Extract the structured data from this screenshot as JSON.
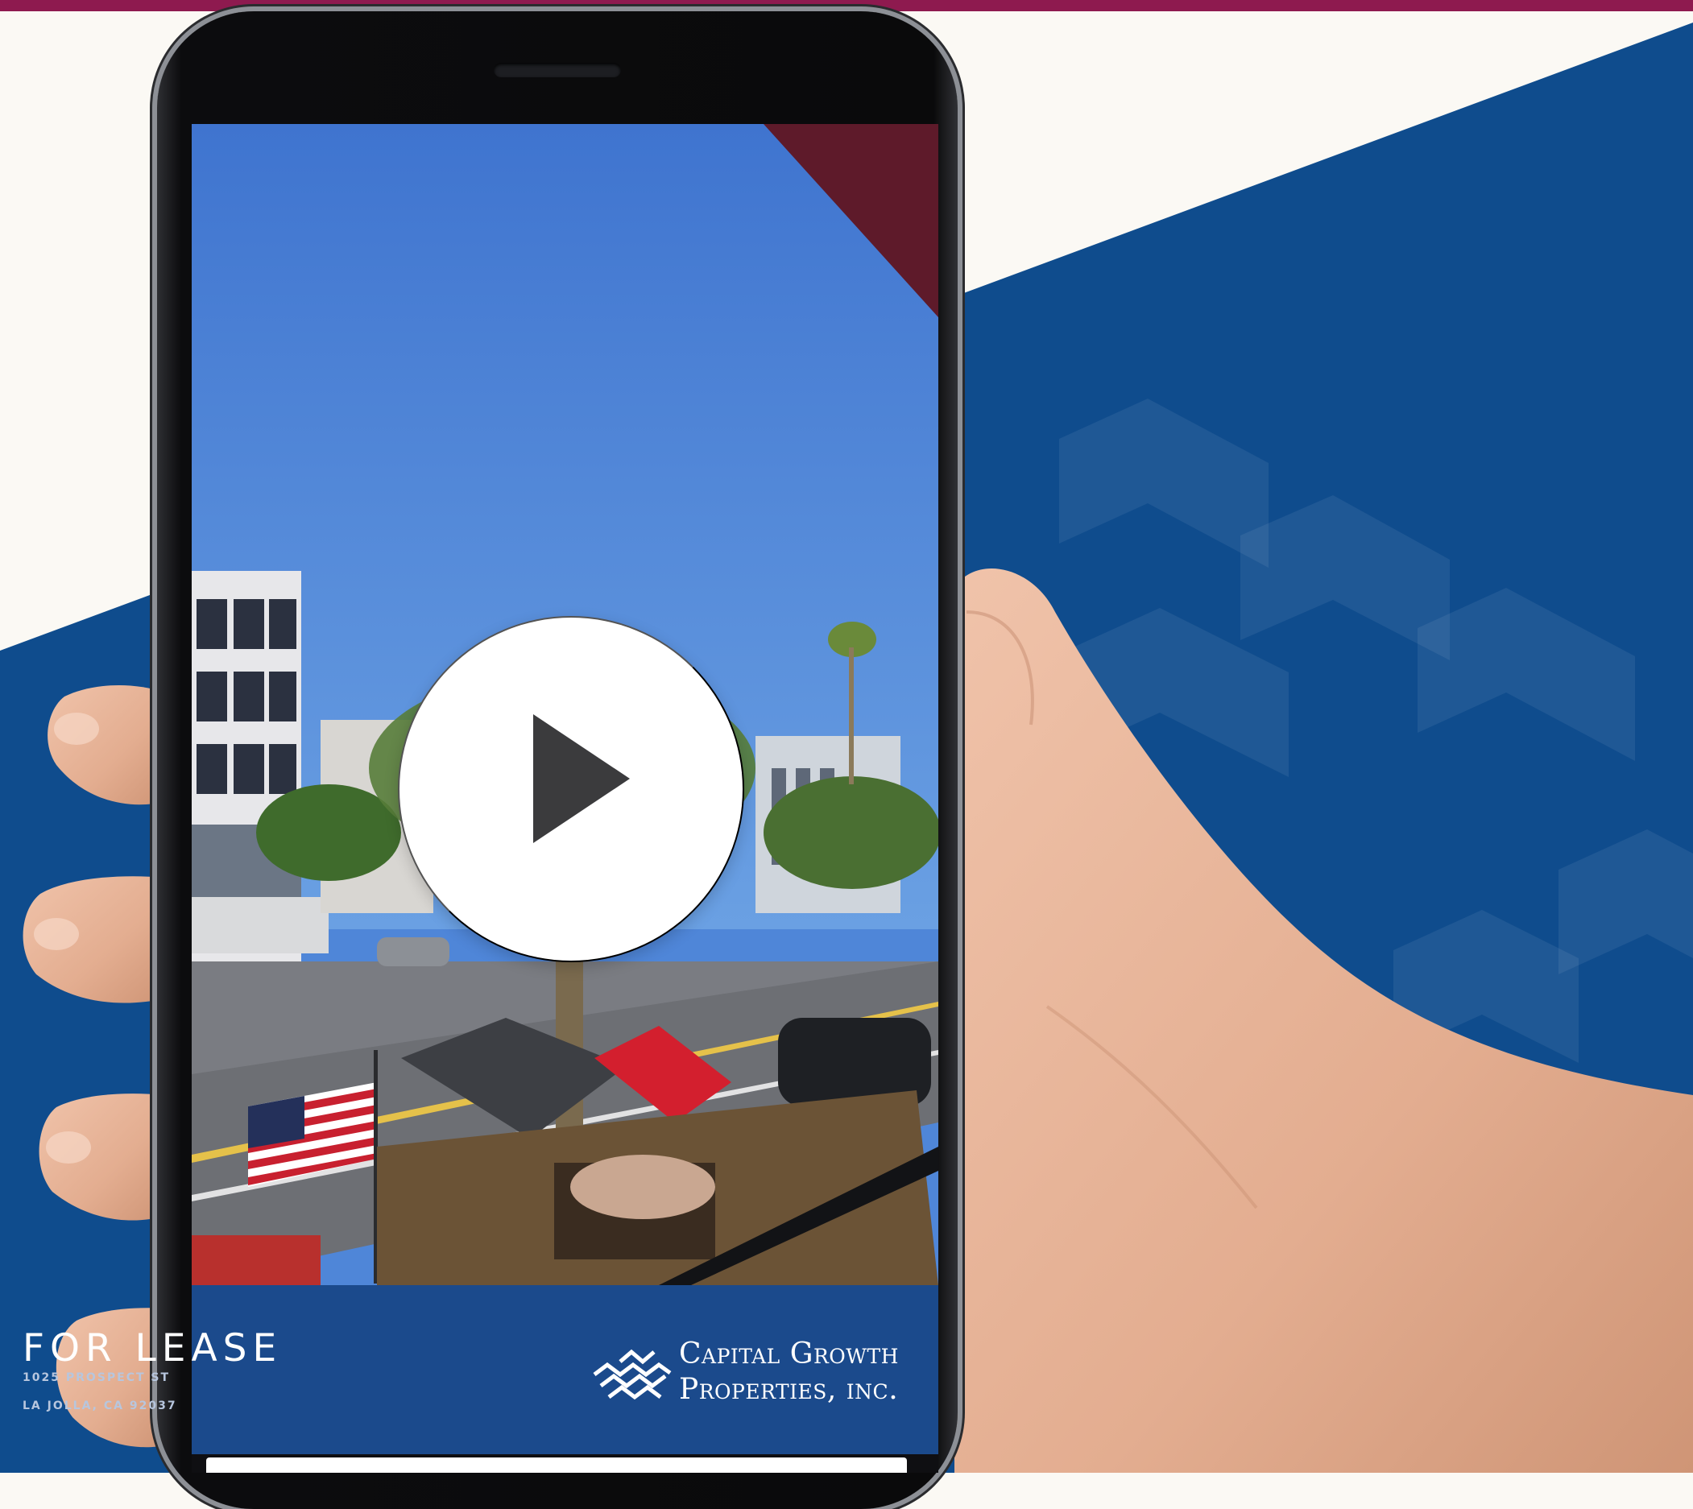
{
  "video_card": {
    "status": "FOR LEASE",
    "address_line_1": "1025 PROSPECT ST",
    "address_line_2": "LA JOLLA, CA 92037",
    "company_line_1": "Capital Growth",
    "company_line_2": "Properties, inc."
  },
  "icons": {
    "play": "play-icon",
    "logo": "capital-growth-wave-logo"
  },
  "colors": {
    "brand_burgundy": "#8e1a4f",
    "brand_blue": "#0f4c8d",
    "banner_blue": "#1b4a8c",
    "background_cream": "#fbf9f4"
  }
}
